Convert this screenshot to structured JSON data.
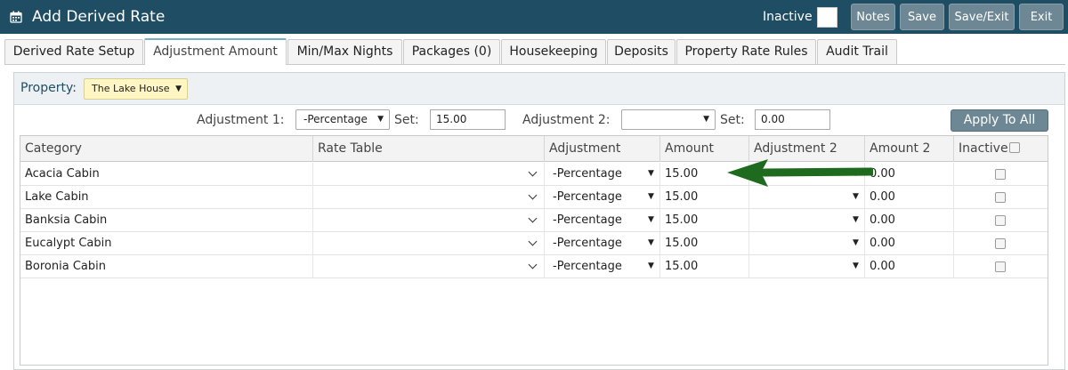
{
  "titlebar": {
    "title": "Add Derived Rate",
    "icon": "calendar-icon",
    "inactive_label": "Inactive",
    "buttons": {
      "notes": "Notes",
      "save": "Save",
      "save_exit": "Save/Exit",
      "exit": "Exit"
    }
  },
  "tabs": [
    {
      "label": "Derived Rate Setup"
    },
    {
      "label": "Adjustment Amount"
    },
    {
      "label": "Min/Max Nights"
    },
    {
      "label": "Packages (0)"
    },
    {
      "label": "Housekeeping"
    },
    {
      "label": "Deposits"
    },
    {
      "label": "Property Rate Rules"
    },
    {
      "label": "Audit Trail"
    }
  ],
  "active_tab": "Adjustment Amount",
  "property": {
    "label": "Property:",
    "value": "The Lake House"
  },
  "adjustments": {
    "adj1_label": "Adjustment 1:",
    "adj1_value": "-Percentage",
    "set1_label": "Set:",
    "set1_value": "15.00",
    "adj2_label": "Adjustment 2:",
    "adj2_value": "",
    "set2_label": "Set:",
    "set2_value": "0.00",
    "apply_label": "Apply To All"
  },
  "grid": {
    "headers": {
      "category": "Category",
      "rate_table": "Rate Table",
      "adjustment": "Adjustment",
      "amount": "Amount",
      "adjustment2": "Adjustment 2",
      "amount2": "Amount 2",
      "inactive": "Inactive"
    },
    "rows": [
      {
        "category": "Acacia Cabin",
        "rate_table": "",
        "adjustment": "-Percentage",
        "amount": "15.00",
        "adjustment2": "",
        "amount2": "0.00"
      },
      {
        "category": "Lake Cabin",
        "rate_table": "",
        "adjustment": "-Percentage",
        "amount": "15.00",
        "adjustment2": "",
        "amount2": "0.00"
      },
      {
        "category": "Banksia Cabin",
        "rate_table": "",
        "adjustment": "-Percentage",
        "amount": "15.00",
        "adjustment2": "",
        "amount2": "0.00"
      },
      {
        "category": "Eucalypt Cabin",
        "rate_table": "",
        "adjustment": "-Percentage",
        "amount": "15.00",
        "adjustment2": "",
        "amount2": "0.00"
      },
      {
        "category": "Boronia Cabin",
        "rate_table": "",
        "adjustment": "-Percentage",
        "amount": "15.00",
        "adjustment2": "",
        "amount2": "0.00"
      }
    ]
  },
  "colors": {
    "titlebar": "#1f4e64",
    "button": "#6d8894",
    "property_select": "#fff6c4",
    "arrow": "#1e6a1e"
  },
  "annotation": {
    "icon": "green-arrow-icon"
  }
}
